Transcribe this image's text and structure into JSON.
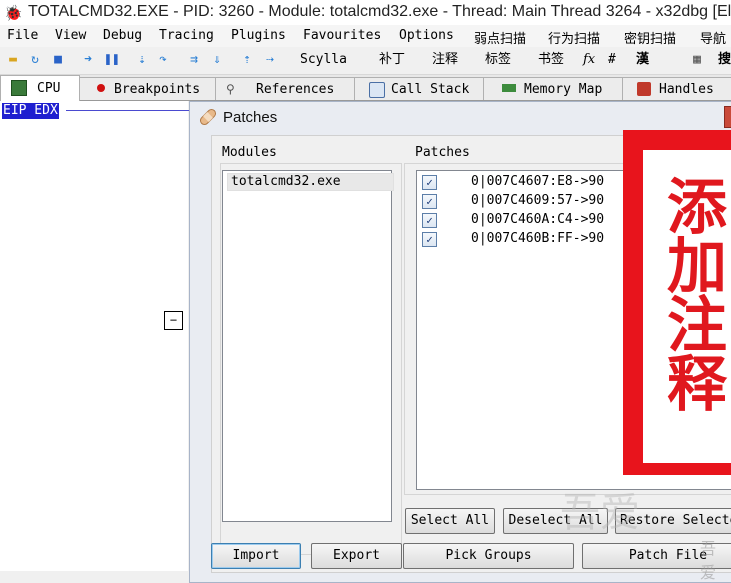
{
  "window": {
    "title": "TOTALCMD32.EXE - PID: 3260 - Module: totalcmd32.exe - Thread: Main Thread 3264 - x32dbg [El"
  },
  "menu": [
    "File",
    "View",
    "Debug",
    "Tracing",
    "Plugins",
    "Favourites",
    "Options",
    "弱点扫描",
    "行为扫描",
    "密钥扫描",
    "导航"
  ],
  "toolbar": {
    "scylla": "Scylla",
    "patch": "补丁",
    "comment": "注释",
    "label": "标签",
    "bookmark": "书签",
    "fx": "fx",
    "hash": "#",
    "han": "漢",
    "search": "搜"
  },
  "tabs": [
    "CPU",
    "Breakpoints",
    "References",
    "Call Stack",
    "Memory Map",
    "Handles"
  ],
  "cpu": {
    "register_label": "EIP EDX",
    "collapse": "−"
  },
  "dialog": {
    "title": "Patches",
    "modules_label": "Modules",
    "patches_label": "Patches",
    "modules": [
      "totalcmd32.exe"
    ],
    "patches": [
      "0|007C4607:E8->90",
      "0|007C4609:57->90",
      "0|007C460A:C4->90",
      "0|007C460B:FF->90"
    ],
    "buttons": {
      "select_all": "Select All",
      "deselect_all": "Deselect All",
      "restore_selected": "Restore Selected",
      "import": "Import",
      "export": "Export",
      "pick_groups": "Pick Groups",
      "patch_file": "Patch File"
    }
  },
  "annotation": {
    "chars": [
      "添",
      "加",
      "注",
      "释"
    ],
    "color": "#e0181e"
  },
  "watermark": {
    "text": "吾爱",
    "sub": "吾爱"
  },
  "colors": {
    "accent": "#1f1fd0",
    "annotation_border": "#e8141c"
  }
}
